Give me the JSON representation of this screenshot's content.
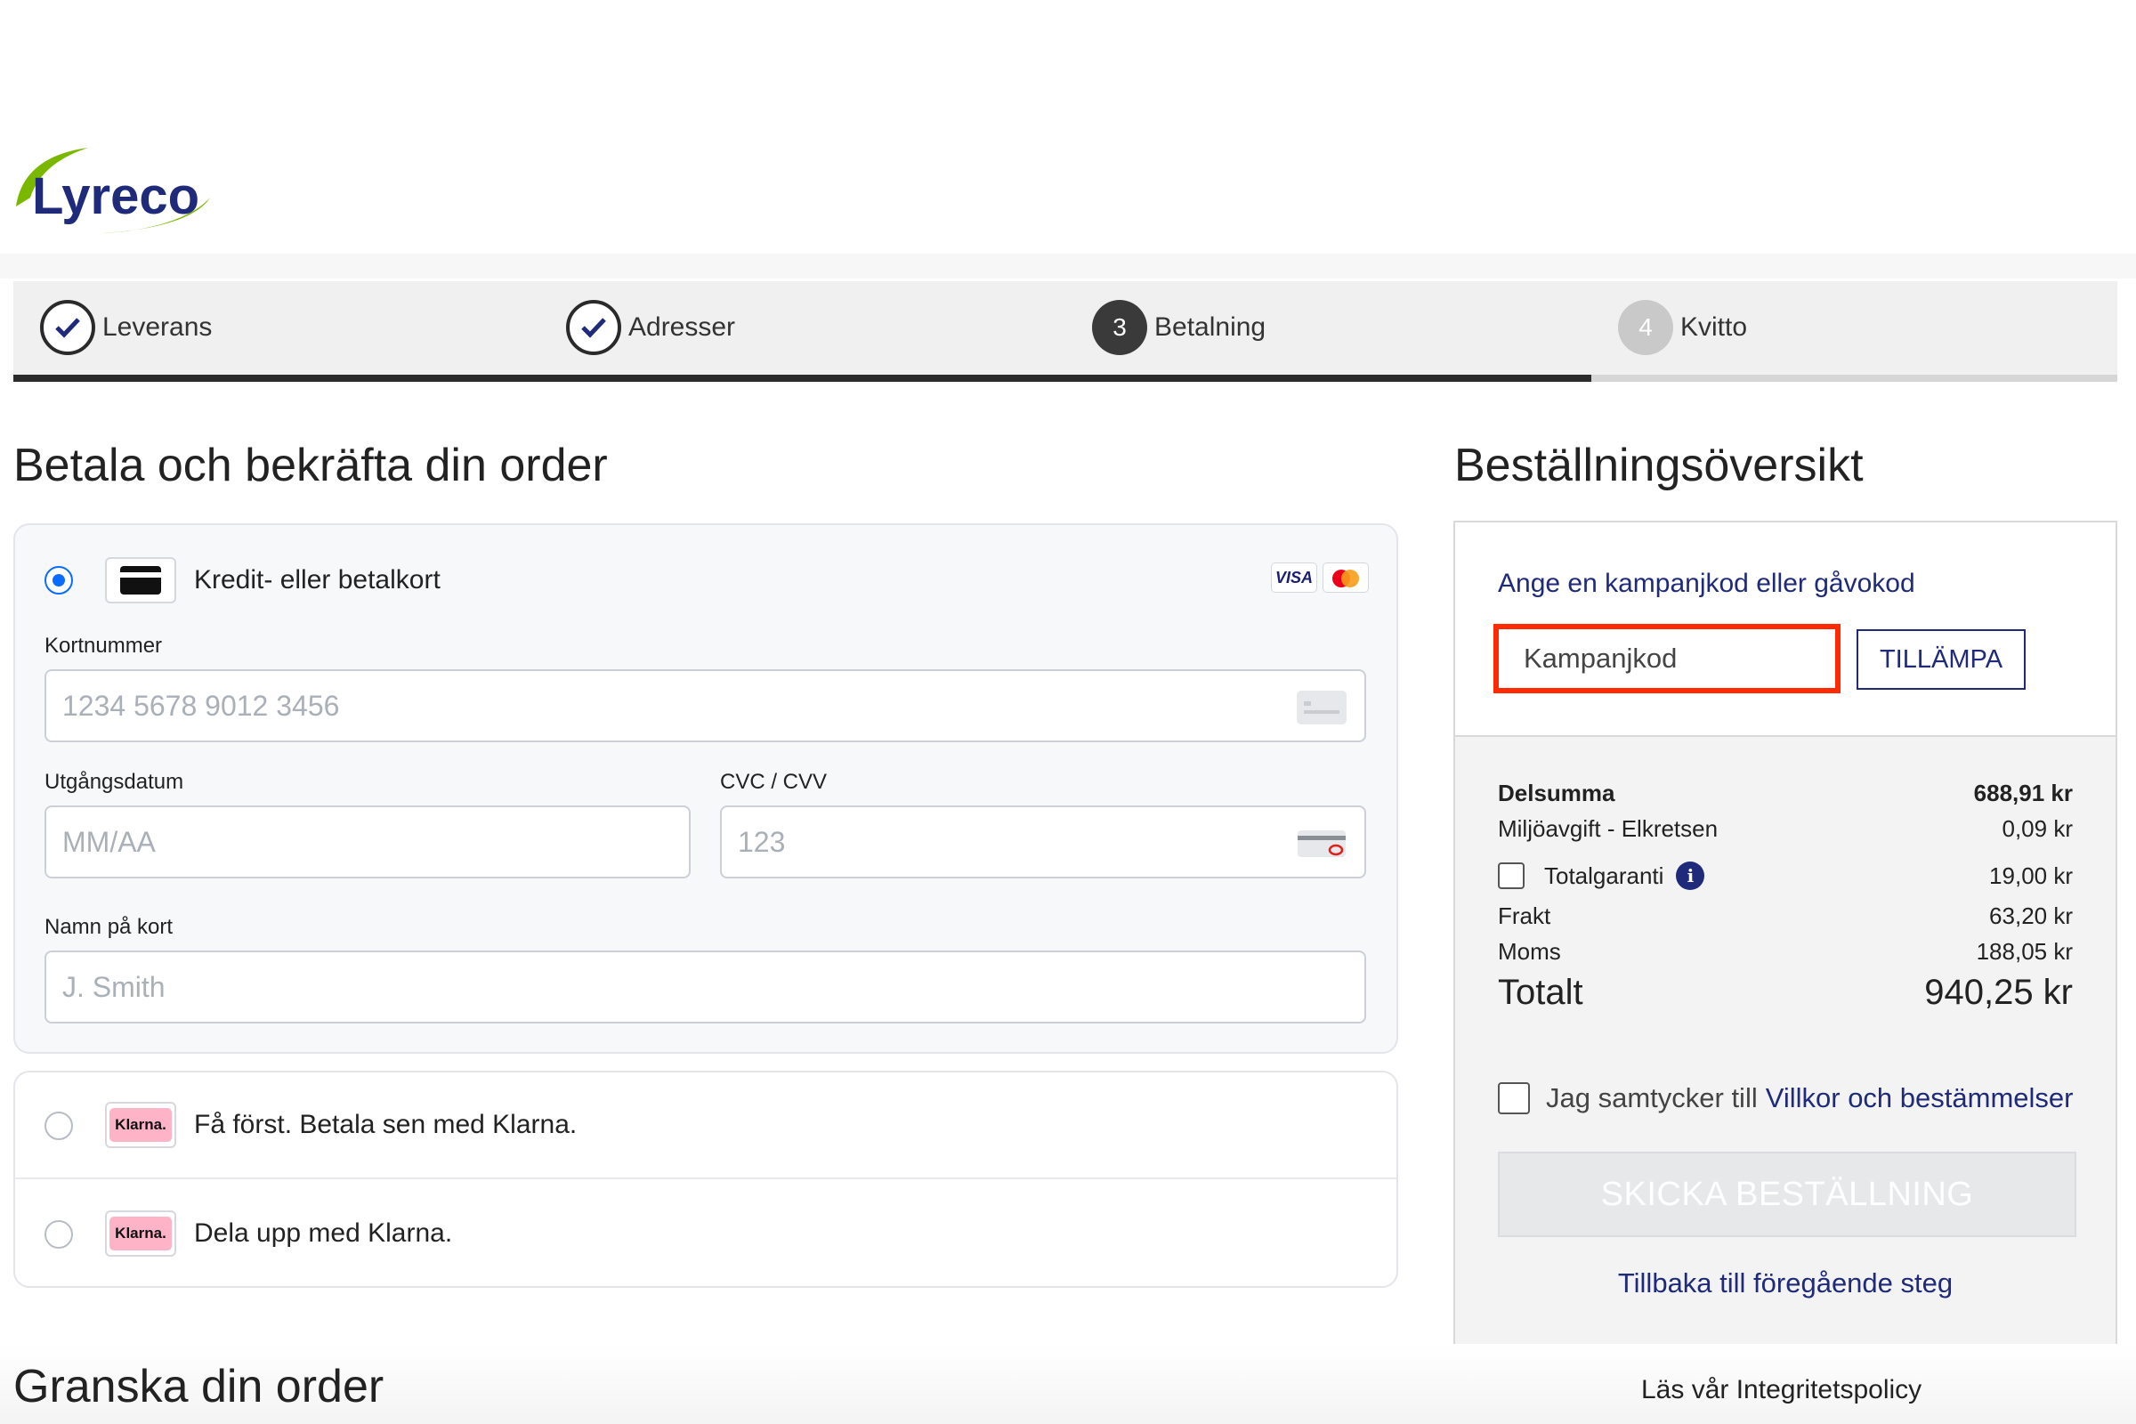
{
  "brand": {
    "logo_text": "Lyreco"
  },
  "stepper": {
    "steps": [
      {
        "number": "",
        "label": "Leverans",
        "state": "done"
      },
      {
        "number": "",
        "label": "Adresser",
        "state": "done"
      },
      {
        "number": "3",
        "label": "Betalning",
        "state": "active"
      },
      {
        "number": "4",
        "label": "Kvitto",
        "state": "todo"
      }
    ],
    "progress_fraction": 0.75
  },
  "payment": {
    "heading": "Betala och bekräfta din order",
    "card": {
      "title": "Kredit- eller betalkort",
      "selected": true,
      "brands": [
        "VISA",
        "mastercard"
      ],
      "card_number": {
        "label": "Kortnummer",
        "placeholder": "1234 5678 9012 3456",
        "value": ""
      },
      "expiry": {
        "label": "Utgångsdatum",
        "placeholder": "MM/AA",
        "value": ""
      },
      "cvc": {
        "label": "CVC / CVV",
        "placeholder": "123",
        "value": ""
      },
      "name": {
        "label": "Namn på kort",
        "placeholder": "J. Smith",
        "value": ""
      }
    },
    "klarna": [
      {
        "badge": "Klarna.",
        "title": "Få först. Betala sen med Klarna.",
        "selected": false
      },
      {
        "badge": "Klarna.",
        "title": "Dela upp med Klarna.",
        "selected": false
      }
    ]
  },
  "review": {
    "heading": "Granska din order"
  },
  "summary": {
    "heading": "Beställningsöversikt",
    "promo": {
      "link": "Ange en kampanjkod eller gåvokod",
      "placeholder": "Kampanjkod",
      "value": "",
      "apply_label": "TILLÄMPA"
    },
    "rows": {
      "subtotal": {
        "label": "Delsumma",
        "value": "688,91 kr"
      },
      "eco_fee": {
        "label": "Miljöavgift - Elkretsen",
        "value": "0,09 kr"
      },
      "warranty": {
        "label": "Totalgaranti",
        "value": "19,00 kr",
        "checked": false
      },
      "shipping": {
        "label": "Frakt",
        "value": "63,20 kr"
      },
      "vat": {
        "label": "Moms",
        "value": "188,05 kr"
      },
      "total": {
        "label": "Totalt",
        "value": "940,25 kr"
      }
    },
    "consent": {
      "text": "Jag samtycker till",
      "link": "Villkor och bestämmelser",
      "checked": false
    },
    "submit_label": "SKICKA BESTÄLLNING",
    "back_link": "Tillbaka till föregående steg"
  },
  "footer": {
    "privacy_link": "Läs vår Integritetspolicy"
  },
  "colors": {
    "accent": "#1f2a7a",
    "radio_active": "#0a6cff",
    "highlight": "#ff2a00",
    "logo_green": "#7ab800",
    "klarna_pink": "#ffb3c7"
  }
}
